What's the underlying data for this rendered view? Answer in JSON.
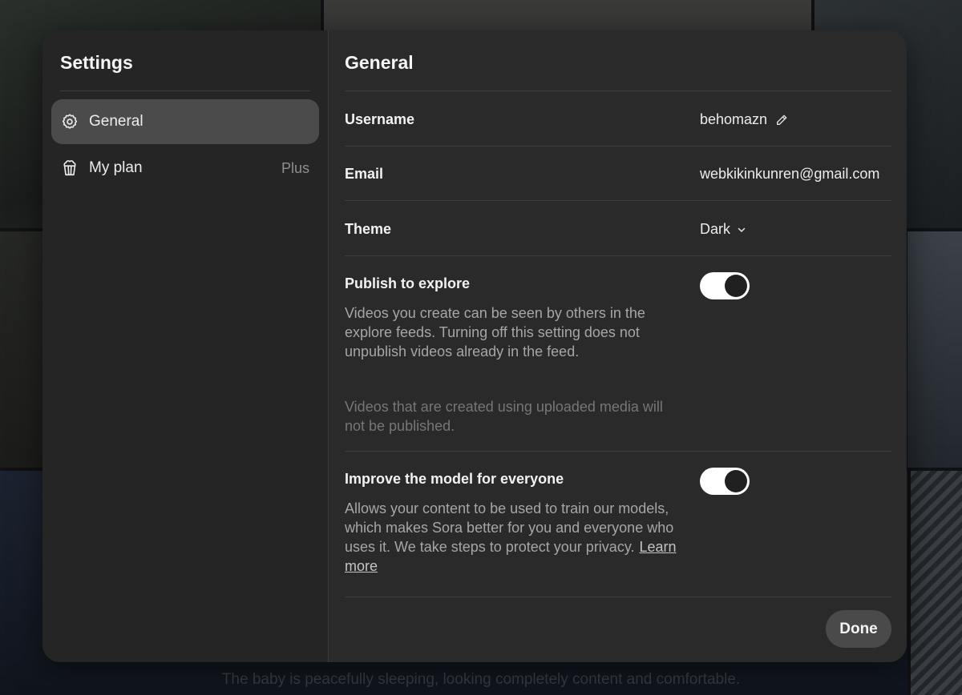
{
  "background": {
    "caption": "The baby is peacefully sleeping, looking completely content and comfortable."
  },
  "sidebar": {
    "title": "Settings",
    "items": [
      {
        "label": "General",
        "icon": "gear-icon",
        "active": true
      },
      {
        "label": "My plan",
        "icon": "popcorn-icon",
        "badge": "Plus"
      }
    ]
  },
  "main": {
    "title": "General",
    "username": {
      "label": "Username",
      "value": "behomazn",
      "icon": "pencil-icon"
    },
    "email": {
      "label": "Email",
      "value": "webkikinkunren@gmail.com"
    },
    "theme": {
      "label": "Theme",
      "value": "Dark",
      "icon": "chevron-down-icon"
    },
    "publish": {
      "label": "Publish to explore",
      "description": "Videos you create can be seen by others in the explore feeds. Turning off this setting does not unpublish videos already in the feed.",
      "note": "Videos that are created using uploaded media will not be published.",
      "enabled": true
    },
    "improve": {
      "label": "Improve the model for everyone",
      "description": "Allows your content to be used to train our models, which makes Sora better for you and everyone who uses it. We take steps to protect your privacy.",
      "link": "Learn more",
      "enabled": true
    },
    "done_label": "Done"
  }
}
